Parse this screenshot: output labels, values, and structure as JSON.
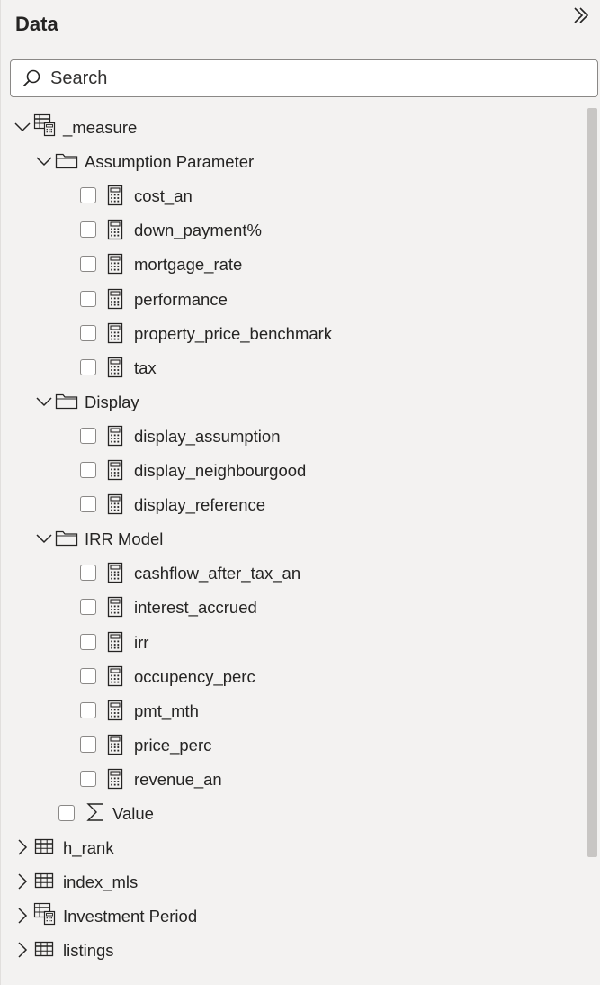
{
  "pane": {
    "title": "Data"
  },
  "search": {
    "placeholder": "Search"
  },
  "tree": {
    "measure_table": {
      "label": "_measure",
      "expanded": true
    },
    "folders": [
      {
        "label": "Assumption Parameter",
        "expanded": true,
        "items": [
          "cost_an",
          "down_payment%",
          "mortgage_rate",
          "performance",
          "property_price_benchmark",
          "tax"
        ]
      },
      {
        "label": "Display",
        "expanded": true,
        "items": [
          "display_assumption",
          "display_neighbourgood",
          "display_reference"
        ]
      },
      {
        "label": "IRR Model",
        "expanded": true,
        "items": [
          "cashflow_after_tax_an",
          "interest_accrued",
          "irr",
          "occupency_perc",
          "pmt_mth",
          "price_perc",
          "revenue_an"
        ]
      }
    ],
    "sum_field": {
      "label": "Value"
    },
    "tables": [
      {
        "label": "h_rank",
        "icon": "table-icon"
      },
      {
        "label": "index_mls",
        "icon": "table-icon"
      },
      {
        "label": "Investment Period",
        "icon": "measure-table-icon"
      },
      {
        "label": "listings",
        "icon": "table-icon"
      }
    ]
  }
}
